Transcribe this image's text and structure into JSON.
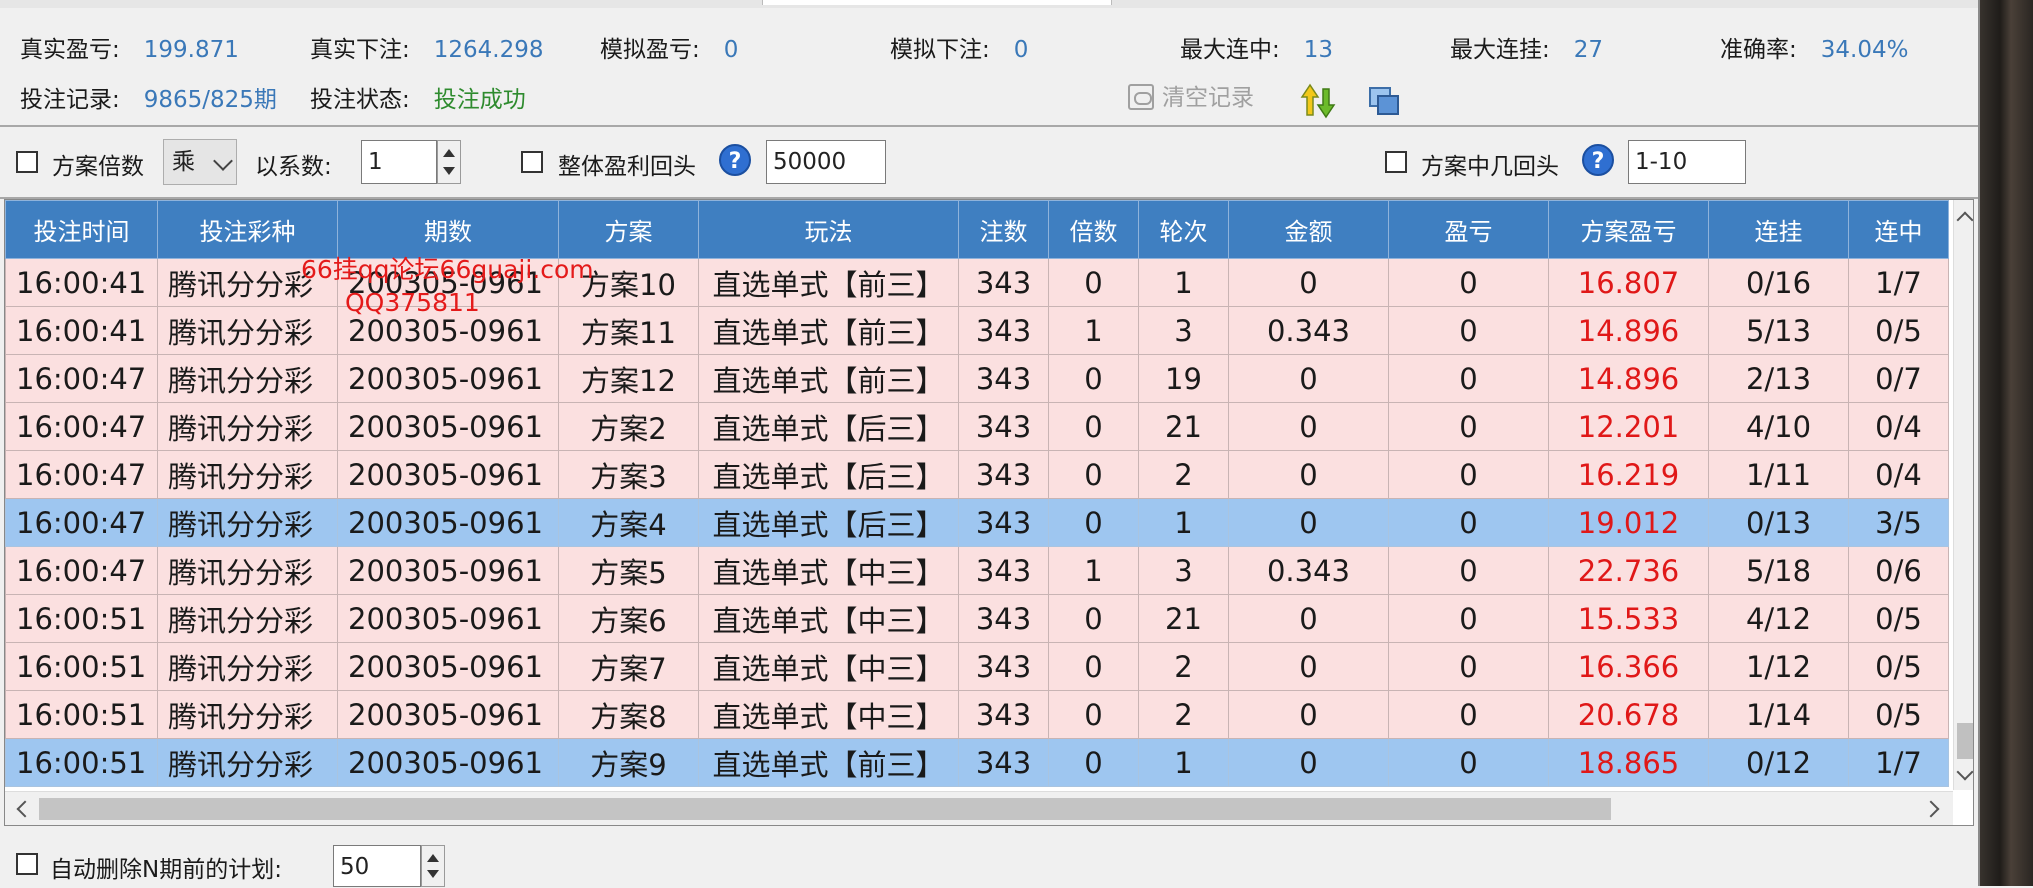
{
  "stats": {
    "real_profit": {
      "label": "真实盈亏:",
      "value": "199.871"
    },
    "real_bet": {
      "label": "真实下注:",
      "value": "1264.298"
    },
    "sim_profit": {
      "label": "模拟盈亏:",
      "value": "0"
    },
    "sim_bet": {
      "label": "模拟下注:",
      "value": "0"
    },
    "max_streak_hit": {
      "label": "最大连中:",
      "value": "13"
    },
    "max_streak_miss": {
      "label": "最大连挂:",
      "value": "27"
    },
    "accuracy": {
      "label": "准确率:",
      "value": "34.04%"
    },
    "bet_record": {
      "label": "投注记录:",
      "value": "9865/825期"
    },
    "bet_status": {
      "label": "投注状态:",
      "value": "投注成功"
    },
    "clear_label": "清空记录",
    "status_color": "#2e8b2e",
    "value_color": "#3a78b8"
  },
  "options": {
    "plan_multiplier_label": "方案倍数",
    "op_value": "乘",
    "coef_label": "以系数:",
    "coef_value": "1",
    "overall_profit_back_label": "整体盈利回头",
    "overall_profit_back_value": "50000",
    "plan_hit_back_label": "方案中几回头",
    "plan_hit_back_value": "1-10",
    "help_glyph": "?"
  },
  "grid": {
    "columns": [
      "投注时间",
      "投注彩种",
      "期数",
      "方案",
      "玩法",
      "注数",
      "倍数",
      "轮次",
      "金额",
      "盈亏",
      "方案盈亏",
      "连挂",
      "连中"
    ],
    "rows": [
      {
        "time": "16:00:41",
        "lottery": "腾讯分分彩",
        "period": "200305-0961",
        "plan": "方案10",
        "play": "直选单式【前三】",
        "count": "343",
        "mult": "0",
        "round": "1",
        "amount": "0",
        "profit": "0",
        "plan_profit": "16.807",
        "miss": "0/16",
        "hit": "1/7",
        "selected": false
      },
      {
        "time": "16:00:41",
        "lottery": "腾讯分分彩",
        "period": "200305-0961",
        "plan": "方案11",
        "play": "直选单式【前三】",
        "count": "343",
        "mult": "1",
        "round": "3",
        "amount": "0.343",
        "profit": "0",
        "plan_profit": "14.896",
        "miss": "5/13",
        "hit": "0/5",
        "selected": false
      },
      {
        "time": "16:00:47",
        "lottery": "腾讯分分彩",
        "period": "200305-0961",
        "plan": "方案12",
        "play": "直选单式【前三】",
        "count": "343",
        "mult": "0",
        "round": "19",
        "amount": "0",
        "profit": "0",
        "plan_profit": "14.896",
        "miss": "2/13",
        "hit": "0/7",
        "selected": false
      },
      {
        "time": "16:00:47",
        "lottery": "腾讯分分彩",
        "period": "200305-0961",
        "plan": "方案2",
        "play": "直选单式【后三】",
        "count": "343",
        "mult": "0",
        "round": "21",
        "amount": "0",
        "profit": "0",
        "plan_profit": "12.201",
        "miss": "4/10",
        "hit": "0/4",
        "selected": false
      },
      {
        "time": "16:00:47",
        "lottery": "腾讯分分彩",
        "period": "200305-0961",
        "plan": "方案3",
        "play": "直选单式【后三】",
        "count": "343",
        "mult": "0",
        "round": "2",
        "amount": "0",
        "profit": "0",
        "plan_profit": "16.219",
        "miss": "1/11",
        "hit": "0/4",
        "selected": false
      },
      {
        "time": "16:00:47",
        "lottery": "腾讯分分彩",
        "period": "200305-0961",
        "plan": "方案4",
        "play": "直选单式【后三】",
        "count": "343",
        "mult": "0",
        "round": "1",
        "amount": "0",
        "profit": "0",
        "plan_profit": "19.012",
        "miss": "0/13",
        "hit": "3/5",
        "selected": true
      },
      {
        "time": "16:00:47",
        "lottery": "腾讯分分彩",
        "period": "200305-0961",
        "plan": "方案5",
        "play": "直选单式【中三】",
        "count": "343",
        "mult": "1",
        "round": "3",
        "amount": "0.343",
        "profit": "0",
        "plan_profit": "22.736",
        "miss": "5/18",
        "hit": "0/6",
        "selected": false
      },
      {
        "time": "16:00:51",
        "lottery": "腾讯分分彩",
        "period": "200305-0961",
        "plan": "方案6",
        "play": "直选单式【中三】",
        "count": "343",
        "mult": "0",
        "round": "21",
        "amount": "0",
        "profit": "0",
        "plan_profit": "15.533",
        "miss": "4/12",
        "hit": "0/5",
        "selected": false
      },
      {
        "time": "16:00:51",
        "lottery": "腾讯分分彩",
        "period": "200305-0961",
        "plan": "方案7",
        "play": "直选单式【中三】",
        "count": "343",
        "mult": "0",
        "round": "2",
        "amount": "0",
        "profit": "0",
        "plan_profit": "16.366",
        "miss": "1/12",
        "hit": "0/5",
        "selected": false
      },
      {
        "time": "16:00:51",
        "lottery": "腾讯分分彩",
        "period": "200305-0961",
        "plan": "方案8",
        "play": "直选单式【中三】",
        "count": "343",
        "mult": "0",
        "round": "2",
        "amount": "0",
        "profit": "0",
        "plan_profit": "20.678",
        "miss": "1/14",
        "hit": "0/5",
        "selected": false
      },
      {
        "time": "16:00:51",
        "lottery": "腾讯分分彩",
        "period": "200305-0961",
        "plan": "方案9",
        "play": "直选单式【前三】",
        "count": "343",
        "mult": "0",
        "round": "1",
        "amount": "0",
        "profit": "0",
        "plan_profit": "18.865",
        "miss": "0/12",
        "hit": "1/7",
        "selected": true
      }
    ],
    "header_color": "#3f7fc1",
    "row_color": "#fbe0e0",
    "selected_color": "#9ec6f0",
    "plan_profit_color": "#e01818"
  },
  "watermark": {
    "line1": "66挂qq论坛66guaji.com",
    "line2": "QQ375811"
  },
  "bottom": {
    "auto_delete_label": "自动删除N期前的计划:",
    "auto_delete_value": "50"
  }
}
